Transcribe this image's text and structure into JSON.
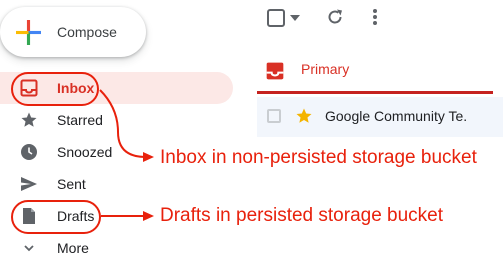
{
  "compose": {
    "label": "Compose"
  },
  "nav": {
    "items": [
      {
        "label": "Inbox",
        "icon": "inbox-icon",
        "active": true
      },
      {
        "label": "Starred",
        "icon": "star-icon",
        "active": false
      },
      {
        "label": "Snoozed",
        "icon": "clock-icon",
        "active": false
      },
      {
        "label": "Sent",
        "icon": "send-icon",
        "active": false
      },
      {
        "label": "Drafts",
        "icon": "draft-icon",
        "active": false
      },
      {
        "label": "More",
        "icon": "chevron-down-icon",
        "active": false
      }
    ]
  },
  "toolbar": {
    "icons": [
      "select-checkbox-icon",
      "caret-down-icon",
      "refresh-icon",
      "more-vert-icon"
    ]
  },
  "tabs": [
    {
      "label": "Primary",
      "icon": "inbox-icon",
      "active": true
    }
  ],
  "messages": [
    {
      "sender": "Google Community Te.",
      "starred": true
    }
  ],
  "annotations": [
    {
      "text": "Inbox in non-persisted storage bucket"
    },
    {
      "text": "Drafts in persisted storage bucket"
    }
  ],
  "colors": {
    "accent": "#d93025",
    "annotation": "#e8210c",
    "active_bg": "#fce8e6",
    "star": "#f4b400"
  }
}
